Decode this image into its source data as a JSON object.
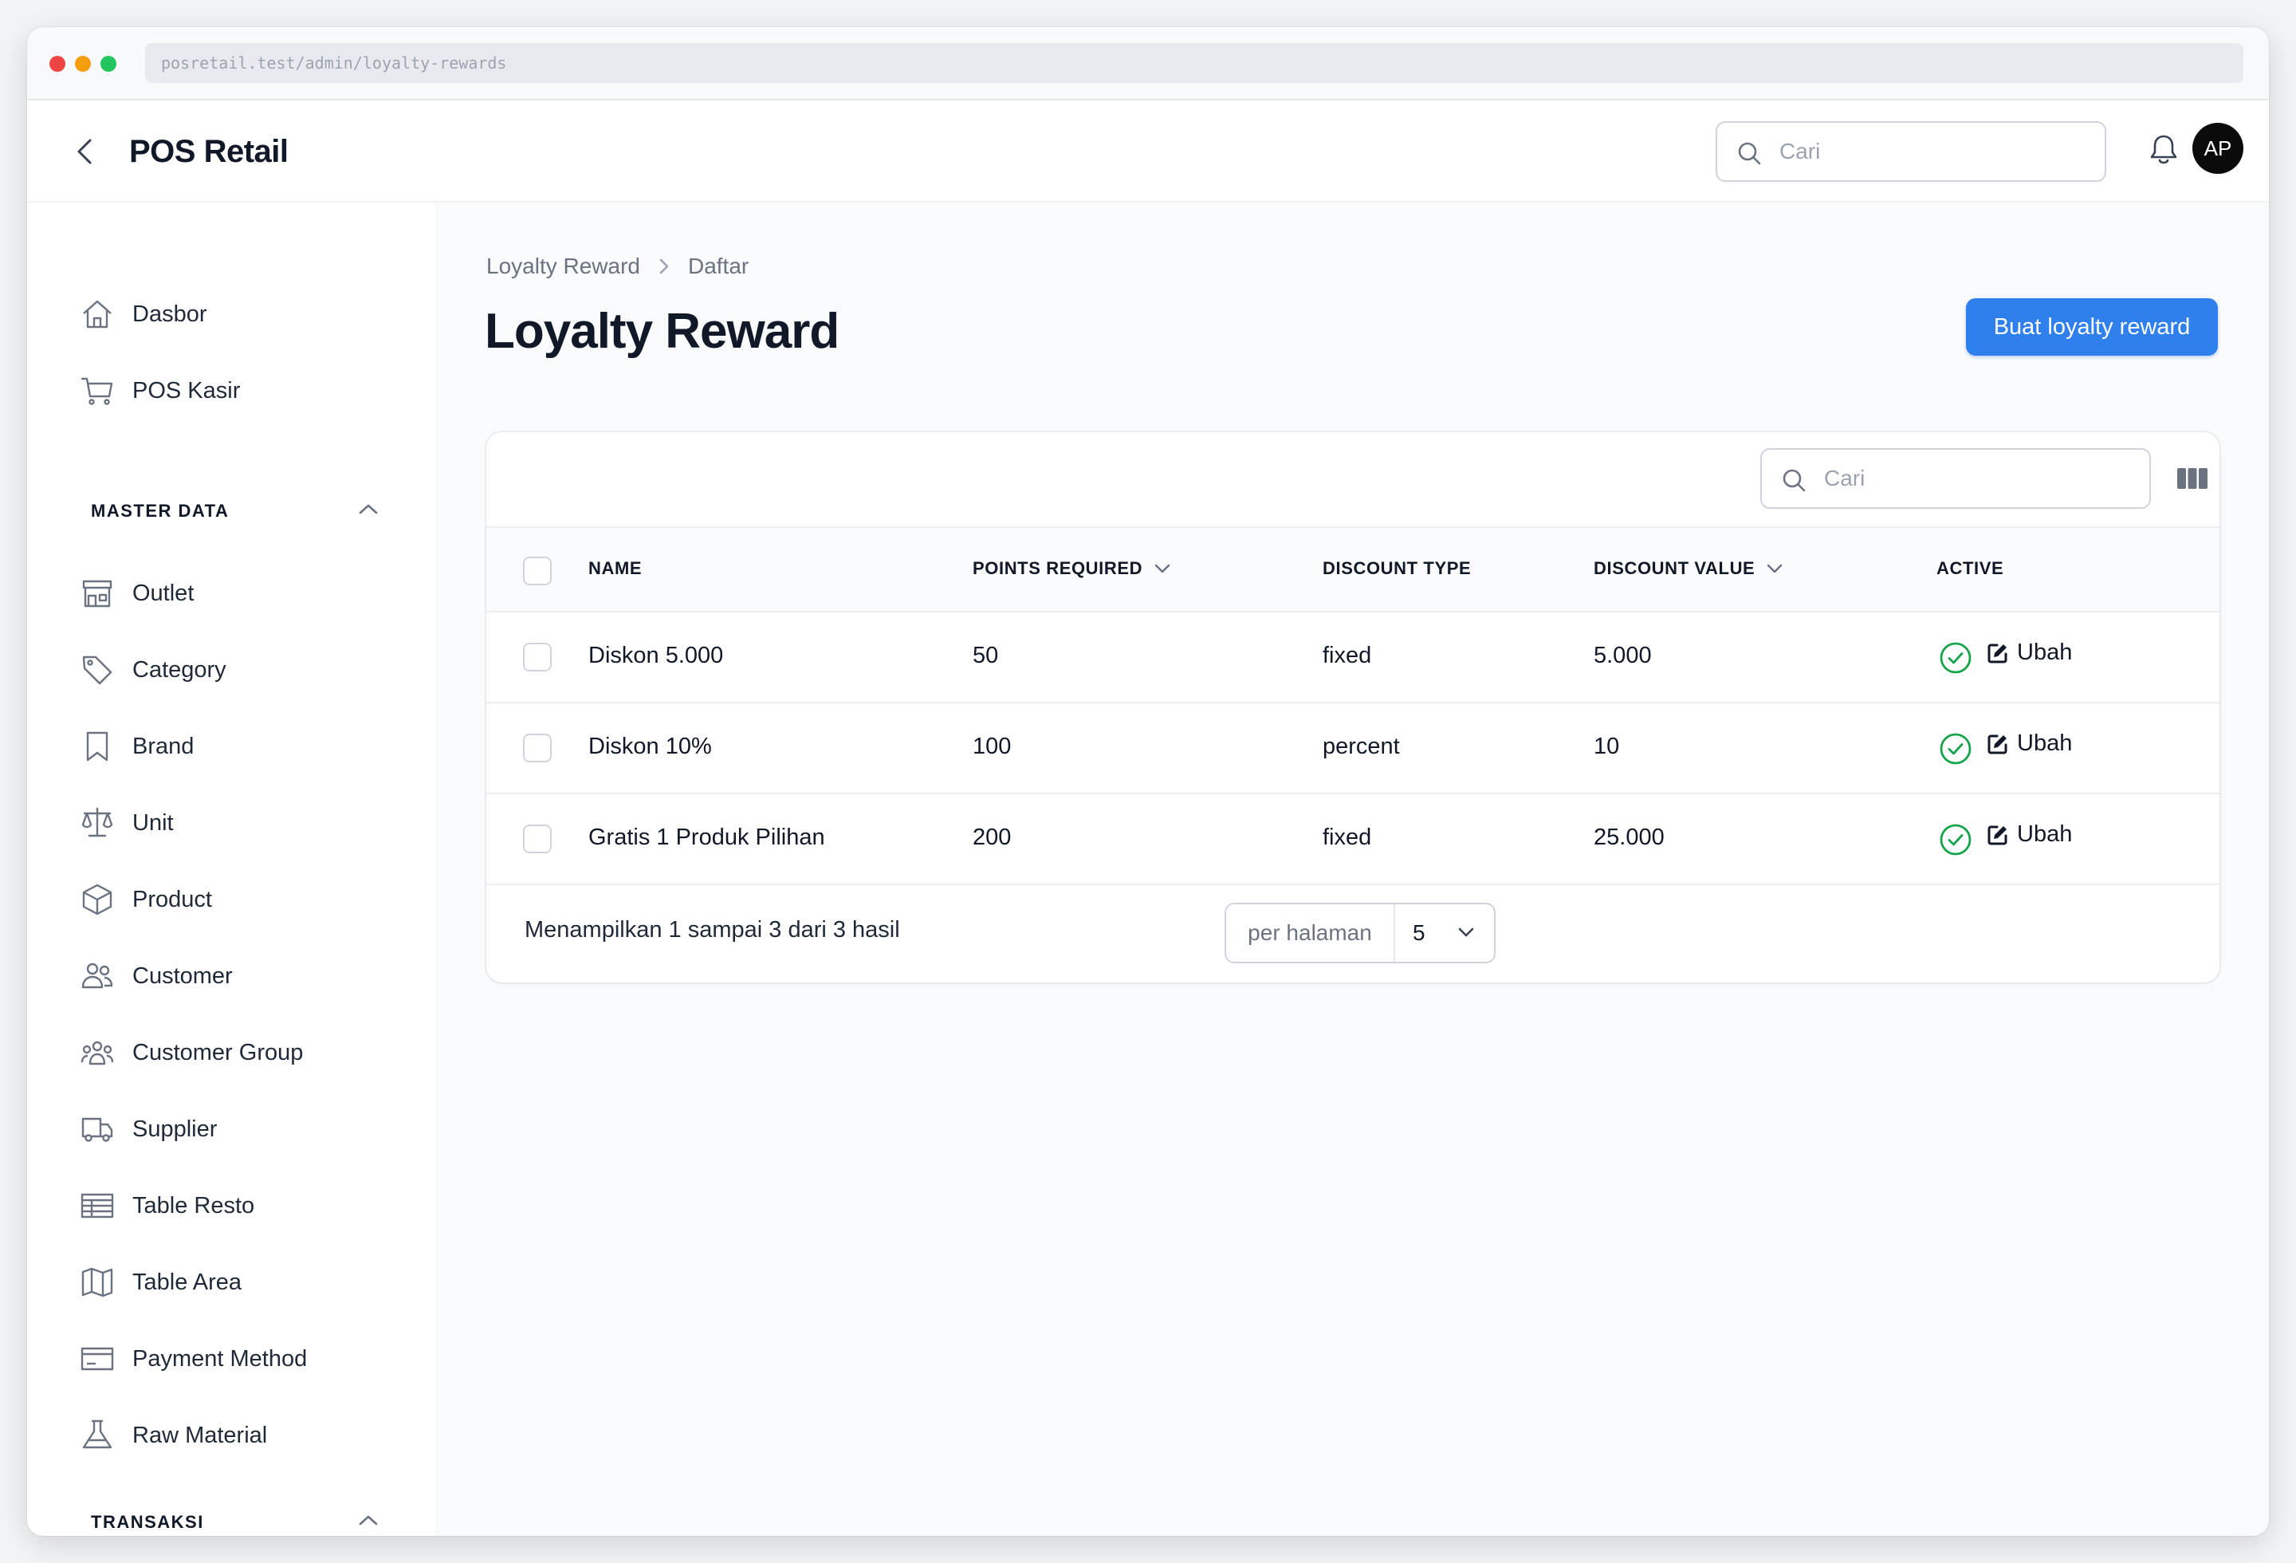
{
  "browser": {
    "url": "posretail.test/admin/loyalty-rewards"
  },
  "header": {
    "brand": "POS Retail",
    "search_placeholder": "Cari",
    "avatar_initials": "AP"
  },
  "sidebar": {
    "top_items": [
      {
        "label": "Dasbor",
        "icon": "home-icon"
      },
      {
        "label": "POS Kasir",
        "icon": "cart-icon"
      }
    ],
    "groups": [
      {
        "title": "MASTER DATA",
        "expanded": true,
        "items": [
          {
            "label": "Outlet",
            "icon": "store-icon"
          },
          {
            "label": "Category",
            "icon": "tag-icon"
          },
          {
            "label": "Brand",
            "icon": "bookmark-icon"
          },
          {
            "label": "Unit",
            "icon": "scale-icon"
          },
          {
            "label": "Product",
            "icon": "cube-icon"
          },
          {
            "label": "Customer",
            "icon": "users-icon"
          },
          {
            "label": "Customer Group",
            "icon": "user-group-icon"
          },
          {
            "label": "Supplier",
            "icon": "truck-icon"
          },
          {
            "label": "Table Resto",
            "icon": "table-icon"
          },
          {
            "label": "Table Area",
            "icon": "map-icon"
          },
          {
            "label": "Payment Method",
            "icon": "credit-card-icon"
          },
          {
            "label": "Raw Material",
            "icon": "beaker-icon"
          }
        ]
      },
      {
        "title": "TRANSAKSI",
        "expanded": true,
        "items": []
      }
    ]
  },
  "main": {
    "breadcrumb": [
      "Loyalty Reward",
      "Daftar"
    ],
    "title": "Loyalty Reward",
    "create_button": "Buat loyalty reward",
    "table": {
      "search_placeholder": "Cari",
      "columns": [
        {
          "label": "NAME",
          "sortable": false
        },
        {
          "label": "POINTS REQUIRED",
          "sortable": true
        },
        {
          "label": "DISCOUNT TYPE",
          "sortable": false
        },
        {
          "label": "DISCOUNT VALUE",
          "sortable": true
        },
        {
          "label": "ACTIVE",
          "sortable": false
        }
      ],
      "rows": [
        {
          "name": "Diskon 5.000",
          "points_required": "50",
          "discount_type": "fixed",
          "discount_value": "5.000",
          "active": true,
          "action": "Ubah"
        },
        {
          "name": "Diskon 10%",
          "points_required": "100",
          "discount_type": "percent",
          "discount_value": "10",
          "active": true,
          "action": "Ubah"
        },
        {
          "name": "Gratis 1 Produk Pilihan",
          "points_required": "200",
          "discount_type": "fixed",
          "discount_value": "25.000",
          "active": true,
          "action": "Ubah"
        }
      ],
      "footer": {
        "summary": "Menampilkan 1 sampai 3 dari 3 hasil",
        "per_page_label": "per halaman",
        "per_page_value": "5"
      }
    }
  },
  "colors": {
    "primary": "#2f80ed",
    "success": "#16a34a",
    "text": "#111827",
    "muted": "#6b7280",
    "border": "#d1d5db"
  }
}
